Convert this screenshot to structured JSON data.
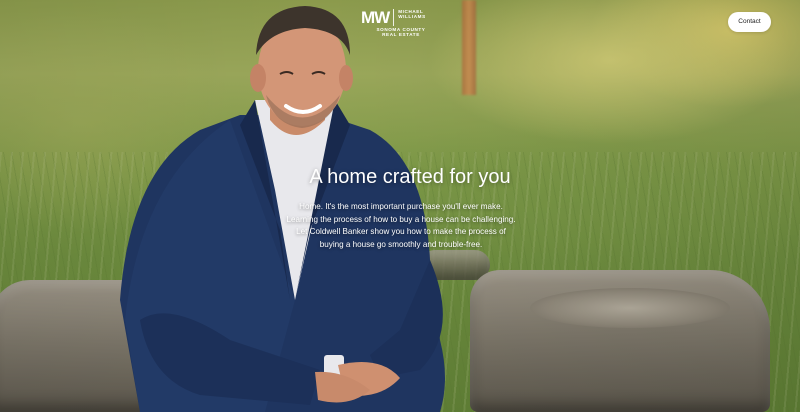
{
  "header": {
    "logo": {
      "mark": "MW",
      "name": "MICHAEL\nWILLIAMS",
      "tagline": "SONOMA COUNTY\nREAL ESTATE"
    },
    "contact_label": "Contact"
  },
  "hero": {
    "title": "A home crafted for you",
    "body_lines": [
      "Home. It's the most important purchase you'll ever make.",
      "Learning the process of how to buy a house can be challenging.",
      "Let Coldwell Banker show you how to make the process of",
      "buying a house go smoothly and trouble-free."
    ]
  },
  "colors": {
    "accent_white": "#ffffff",
    "suit": "#1f3560",
    "shirt": "#e8e8ec"
  }
}
